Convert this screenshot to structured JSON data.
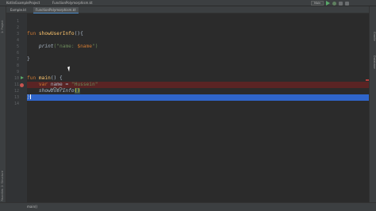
{
  "titlebar": {
    "project": "KotlinExampleProject",
    "file": "FunctionPolymorphism.kt",
    "run_config": "Main"
  },
  "tabs": [
    {
      "label": "Exmple.kt",
      "active": false
    },
    {
      "label": "FunctionPolymorphism.kt",
      "active": true
    }
  ],
  "left_tools": [
    "1: Project",
    "2: Structure",
    "2: Favorites"
  ],
  "right_tools": [
    "Gradle",
    "Database"
  ],
  "line_numbers": [
    "1",
    "2",
    "3",
    "4",
    "5",
    "6",
    "7",
    "8",
    "9",
    "10",
    "11",
    "12",
    "13",
    "14"
  ],
  "code": {
    "l3_kw": "fun",
    "l3_fn": "showUserInfo",
    "l3_rest": "(){",
    "l5_call": "print",
    "l5_open": "(\"name: ",
    "l5_tmpl": "$name",
    "l5_close": "\")",
    "l7": "}",
    "l10_kw": "fun",
    "l10_fn": "main",
    "l10_rest": "() {",
    "l11_kw": "var",
    "l11_name": "name",
    "l11_eq": " = ",
    "l11_str": "\"Hussein\"",
    "l12_call": "showUserInfo",
    "l12_paren": "()",
    "l13": "}"
  },
  "breadcrumb": "main()",
  "colors": {
    "keyword": "#cc7832",
    "function": "#ffc66d",
    "string": "#6a8759",
    "error_line": "#5a2424",
    "current_line": "#2f65ca"
  }
}
